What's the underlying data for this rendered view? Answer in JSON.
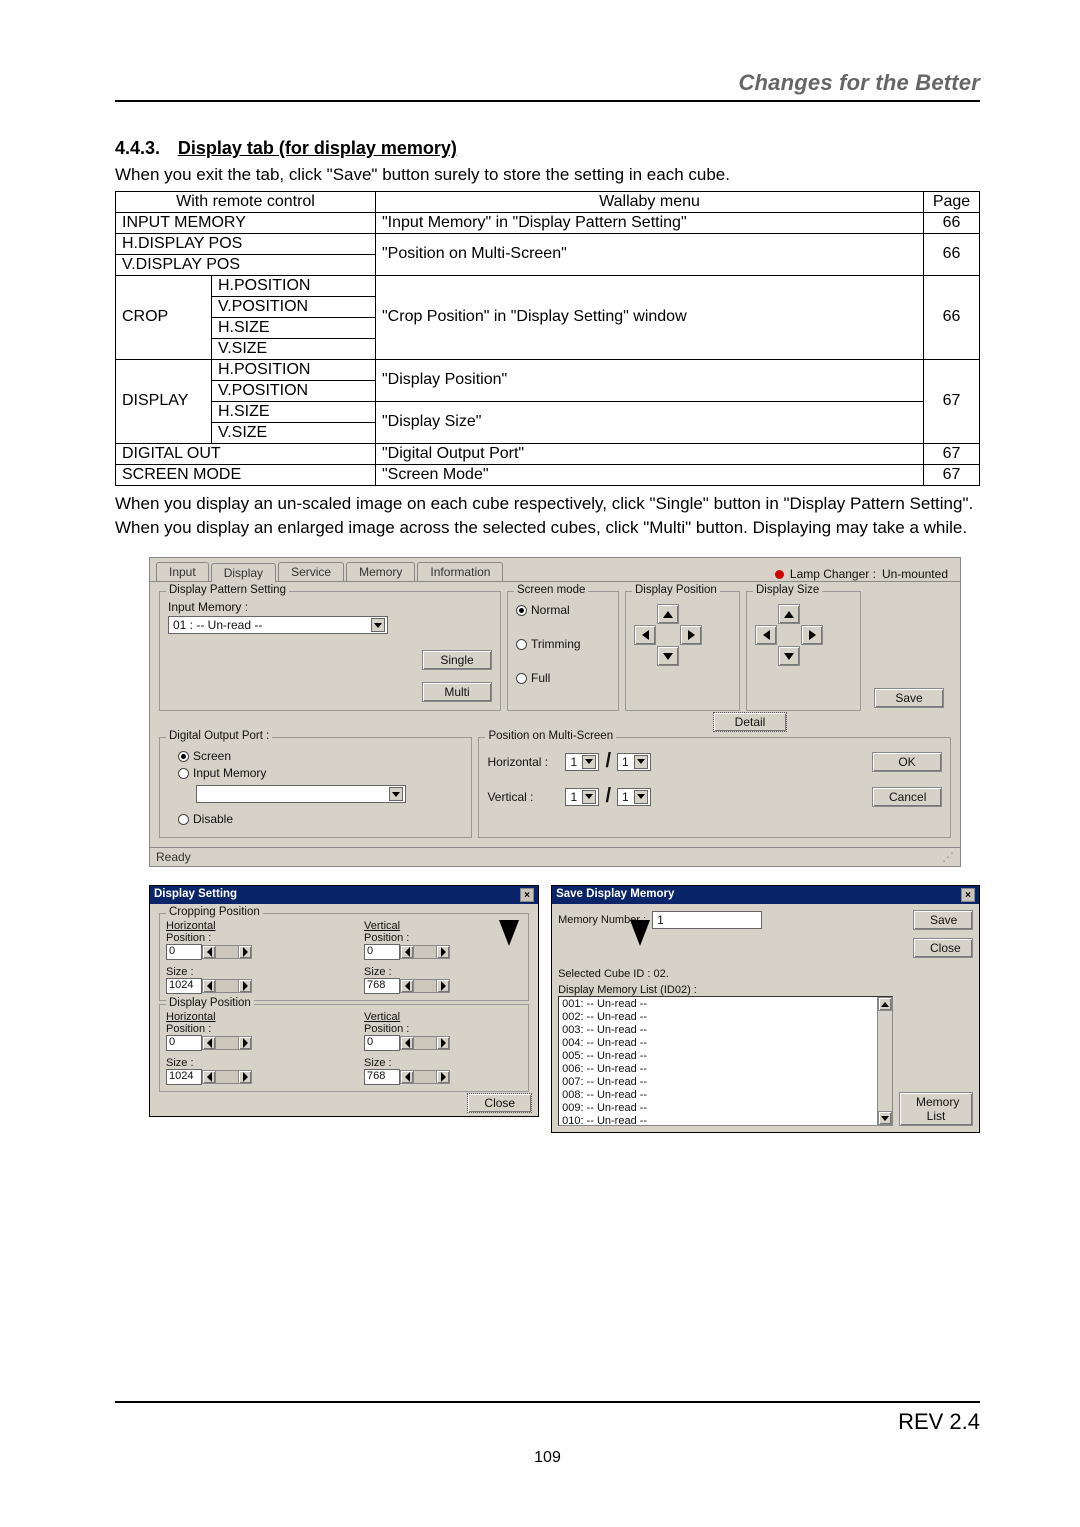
{
  "header": {
    "slogan": "Changes for the Better"
  },
  "section": {
    "number": "4.4.3.",
    "title": "Display tab (for display memory)"
  },
  "paragraph1": "When you exit the tab, click \"Save\" button surely to store the setting in each cube.",
  "table": {
    "h1": "With remote control",
    "h2": "Wallaby menu",
    "h3": "Page",
    "rows": {
      "r1_c1": "INPUT MEMORY",
      "r1_c2": "\"Input Memory\" in \"Display Pattern Setting\"",
      "r1_c3": "66",
      "r2_c1": "H.DISPLAY POS",
      "r3_c1": "V.DISPLAY POS",
      "r23_c2": "\"Position on Multi-Screen\"",
      "r23_c3": "66",
      "crop_lbl": "CROP",
      "r4_c2": "H.POSITION",
      "r5_c2": "V.POSITION",
      "r6_c2": "H.SIZE",
      "r7_c2": "V.SIZE",
      "crop_menu": "\"Crop Position\" in \"Display Setting\" window",
      "crop_page": "66",
      "disp_lbl": "DISPLAY",
      "r8_c2": "H.POSITION",
      "r9_c2": "V.POSITION",
      "r10_c2": "H.SIZE",
      "r11_c2": "V.SIZE",
      "disp_menu1": "\"Display Position\"",
      "disp_menu2": "\"Display Size\"",
      "disp_page": "67",
      "r12_c1": "DIGITAL OUT",
      "r12_c2": "\"Digital Output Port\"",
      "r12_c3": "67",
      "r13_c1": "SCREEN MODE",
      "r13_c2": "\"Screen Mode\"",
      "r13_c3": "67"
    }
  },
  "paragraph2": "When you display an un-scaled image on each cube respectively, click \"Single\" button in \"Display Pattern Setting\". When you display an enlarged image across the selected cubes, click \"Multi\" button. Displaying may take a while.",
  "ui": {
    "tabs": [
      "Input",
      "Display",
      "Service",
      "Memory",
      "Information"
    ],
    "lamp_label": "Lamp Changer :",
    "lamp_value": "Un-mounted",
    "dps": {
      "legend": "Display Pattern Setting",
      "input_mem_label": "Input Memory :",
      "input_mem_value": "01 : -- Un-read --",
      "btn_single": "Single",
      "btn_multi": "Multi"
    },
    "screenmode": {
      "legend": "Screen mode",
      "normal": "Normal",
      "trimming": "Trimming",
      "full": "Full"
    },
    "dpos_legend": "Display Position",
    "dsize_legend": "Display Size",
    "btn_detail": "Detail",
    "btn_save": "Save",
    "dop": {
      "legend": "Digital Output Port :",
      "screen": "Screen",
      "inputmem": "Input Memory",
      "disable": "Disable"
    },
    "poms": {
      "legend": "Position on Multi-Screen",
      "horiz": "Horizontal :",
      "vert": "Vertical :",
      "v1": "1",
      "v2": "1",
      "v3": "1",
      "v4": "1",
      "btn_ok": "OK",
      "btn_cancel": "Cancel"
    },
    "status": "Ready"
  },
  "dlg1": {
    "title": "Display Setting",
    "cropping_legend": "Cropping Position",
    "disp_legend": "Display Position",
    "horiz": "Horizontal",
    "vert": "Vertical",
    "pos_lbl": "Position :",
    "size_lbl": "Size :",
    "v0": "0",
    "v1024": "1024",
    "v768": "768",
    "btn_close": "Close"
  },
  "dlg2": {
    "title": "Save Display Memory",
    "memnum_lbl": "Memory Number :",
    "memnum_val": "1",
    "btn_save": "Save",
    "btn_close": "Close",
    "sel_cube": "Selected Cube ID : 02.",
    "list_head": "Display Memory List (ID02) :",
    "items": [
      "001: -- Un-read --",
      "002: -- Un-read --",
      "003: -- Un-read --",
      "004: -- Un-read --",
      "005: -- Un-read --",
      "006: -- Un-read --",
      "007: -- Un-read --",
      "008: -- Un-read --",
      "009: -- Un-read --",
      "010: -- Un-read --"
    ],
    "btn_memlist": "Memory List"
  },
  "footer": {
    "rev": "REV 2.4",
    "page": "109"
  }
}
